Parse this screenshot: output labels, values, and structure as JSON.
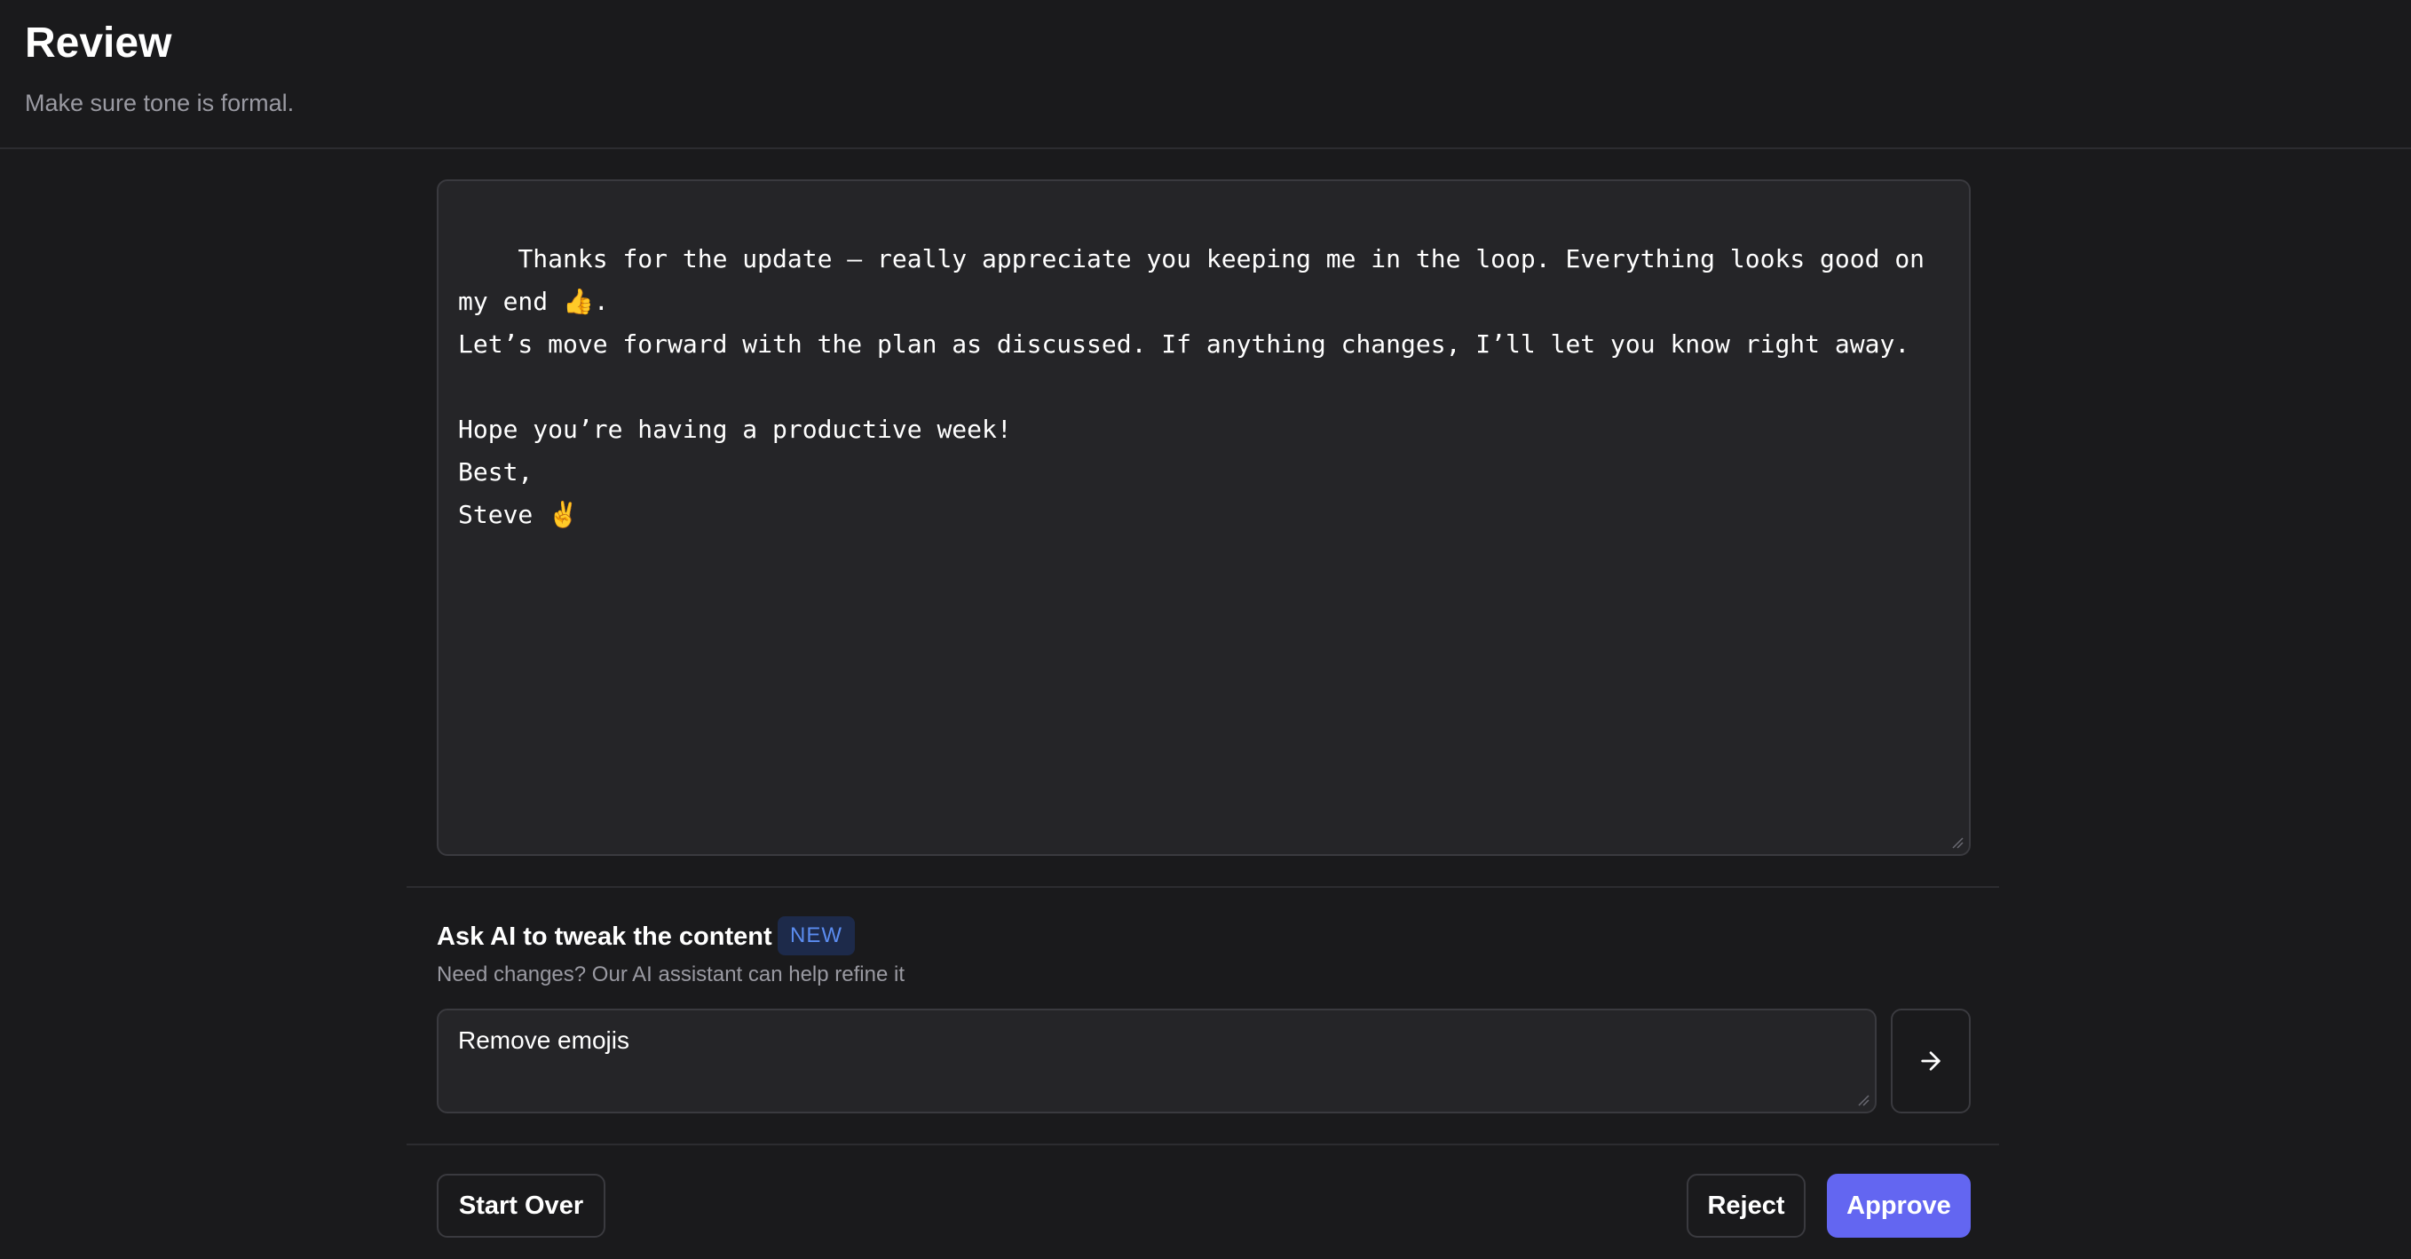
{
  "header": {
    "title": "Review",
    "subtitle": "Make sure tone is formal."
  },
  "editor": {
    "content": "Thanks for the update — really appreciate you keeping me in the loop. Everything looks good on my end 👍.\nLet’s move forward with the plan as discussed. If anything changes, I’ll let you know right away.\n\nHope you’re having a productive week!\nBest,\nSteve ✌️"
  },
  "ai_panel": {
    "title": "Ask AI to tweak the content",
    "badge": "NEW",
    "subtitle": "Need changes? Our AI assistant can help refine it",
    "prompt_value": "Remove emojis",
    "send_icon": "arrow-right-icon"
  },
  "actions": {
    "start_over_label": "Start Over",
    "reject_label": "Reject",
    "approve_label": "Approve"
  },
  "colors": {
    "background": "#1a1a1c",
    "surface": "#252528",
    "border": "#3a3a3f",
    "accent": "#6366f1",
    "badge_text": "#5b8cf0",
    "muted_text": "#9a9aa2"
  }
}
